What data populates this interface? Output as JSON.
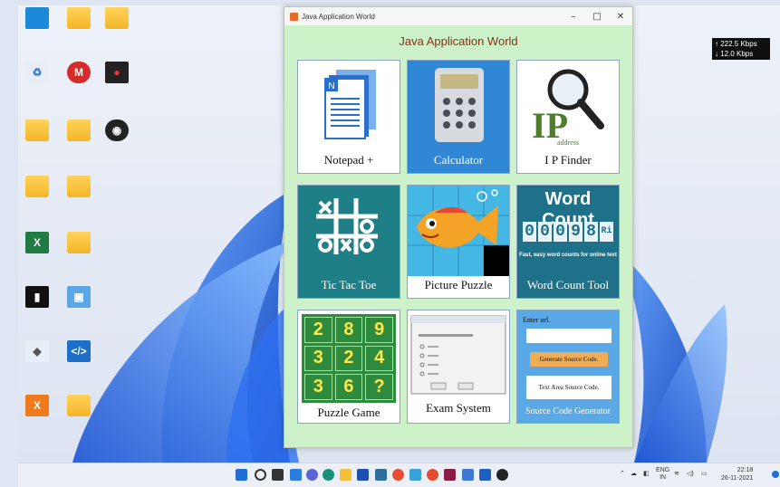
{
  "window": {
    "title": "Java Application World",
    "heading": "Java Application World",
    "controls": {
      "minimize": "–",
      "maximize": "□",
      "close": "✕"
    }
  },
  "tiles": {
    "notepad": {
      "label": "Notepad +"
    },
    "calculator": {
      "label": "Calculator"
    },
    "ipfinder": {
      "label": "I P Finder",
      "art_big": "IP",
      "art_small": "address"
    },
    "tictactoe": {
      "label": "Tic Tac Toe"
    },
    "picturepuzzle": {
      "label": "Picture Puzzle"
    },
    "wordcount": {
      "label": "Word Count Tool",
      "banner": "Word Count",
      "digits": [
        "0",
        "0",
        "0",
        "9",
        "8"
      ],
      "digit_suffix": "Ri",
      "tagline": "Fast, easy word counts for online text"
    },
    "puzzlegame": {
      "label": "Puzzle Game",
      "numbers": [
        "2",
        "8",
        "9",
        "3",
        "2",
        "4",
        "3",
        "6",
        "?"
      ]
    },
    "examsystem": {
      "label": "Exam System"
    },
    "sourcecode": {
      "label": "Source Code Generator",
      "prompt": "Enter url.",
      "generate": "Generate Source Code.",
      "textarea": "Text Area Source Code."
    }
  },
  "net_speed": {
    "up": "↑ 222.5 Kbps",
    "down": "↓ 12.0 Kbps"
  },
  "colors": {
    "window_bg": "#cdf2c9",
    "title_accent": "#8b2d18",
    "notepad_blue": "#2a6fce",
    "calculator_bg": "#2f87d6",
    "tictactoe_teal": "#1f7f86",
    "wordcount_teal": "#1e7188",
    "puzzle_green": "#2e8a3c",
    "source_blue": "#5aa8e6",
    "generate_btn": "#f1ad55"
  },
  "taskbar": {
    "tray_lang": "ENG",
    "tray_region": "IN",
    "time": "22:18",
    "date": "26-11-2021"
  }
}
